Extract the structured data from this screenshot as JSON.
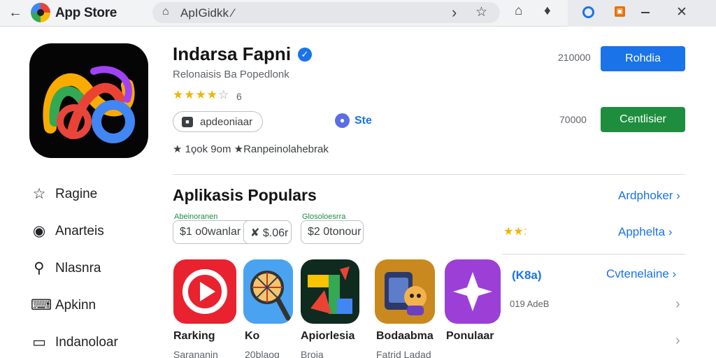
{
  "window": {
    "title": "App Store",
    "url": "ApIGidkk ⁄",
    "icons": [
      "back-arrow-icon",
      "app-store-logo-icon",
      "lock-icon",
      "forward-icon",
      "bookmark-star-icon",
      "home-icon",
      "extension-puzzle-icon",
      "circle-extension-icon",
      "orange-extension-icon",
      "minimize-icon",
      "close-icon"
    ]
  },
  "app": {
    "name": "Indarsa Fapni",
    "developer": "Relonaisis Ba Popedlonk",
    "rating_stars": 4,
    "rating_count": "6",
    "category_chip": "apdeoniaar",
    "site_label": "Ste",
    "meta": "★ 1ϙok 9om ★Ranpeinolahebrak",
    "price_top": "210000",
    "price_bottom": "70000",
    "primary_button": "Rohdia",
    "secondary_button": "Centlisier"
  },
  "sidebar": {
    "items": [
      {
        "label": "Ragine",
        "icon": "star-outline-icon"
      },
      {
        "label": "Anarteis",
        "icon": "shield-chat-icon"
      },
      {
        "label": "Nlasnra",
        "icon": "search-icon"
      },
      {
        "label": "Apkinn",
        "icon": "keyboard-icon"
      },
      {
        "label": "Indanoloar",
        "icon": "monitor-icon"
      }
    ]
  },
  "popular": {
    "title": "Aplikasis Populars",
    "link_1": "Ardphoker",
    "link_2": "Apphelta",
    "link_3": "Cvtenelaine",
    "link_3_badge": "(K8a)",
    "price_chips": [
      {
        "tag": "Abeinoranen",
        "text": "$1 o0wanlar"
      },
      {
        "tag": "",
        "text": "✘ $.06r"
      },
      {
        "tag": "Glosoloesrra",
        "text": "$2 0tonour"
      }
    ],
    "mini_rating": "★★:",
    "small_rating": "019 AdeB",
    "apps": [
      {
        "label": "Rarking",
        "sub": "Sarananin",
        "icon": "play-logo-icon"
      },
      {
        "label": "Ko",
        "sub": "20blaog",
        "icon": "magnifier-wheel-icon"
      },
      {
        "label": "Apiorlesia",
        "sub": "Broia",
        "icon": "colorful-shapes-icon"
      },
      {
        "label": "Bodaabma",
        "sub": "Fatrid Ladad",
        "icon": "character-device-icon"
      },
      {
        "label": "Ponulaar",
        "sub": "",
        "icon": "sparkle-icon"
      }
    ]
  },
  "colors": {
    "accent_blue": "#1a73e8",
    "accent_green": "#1e8e3e",
    "star_gold": "#f4b400"
  }
}
